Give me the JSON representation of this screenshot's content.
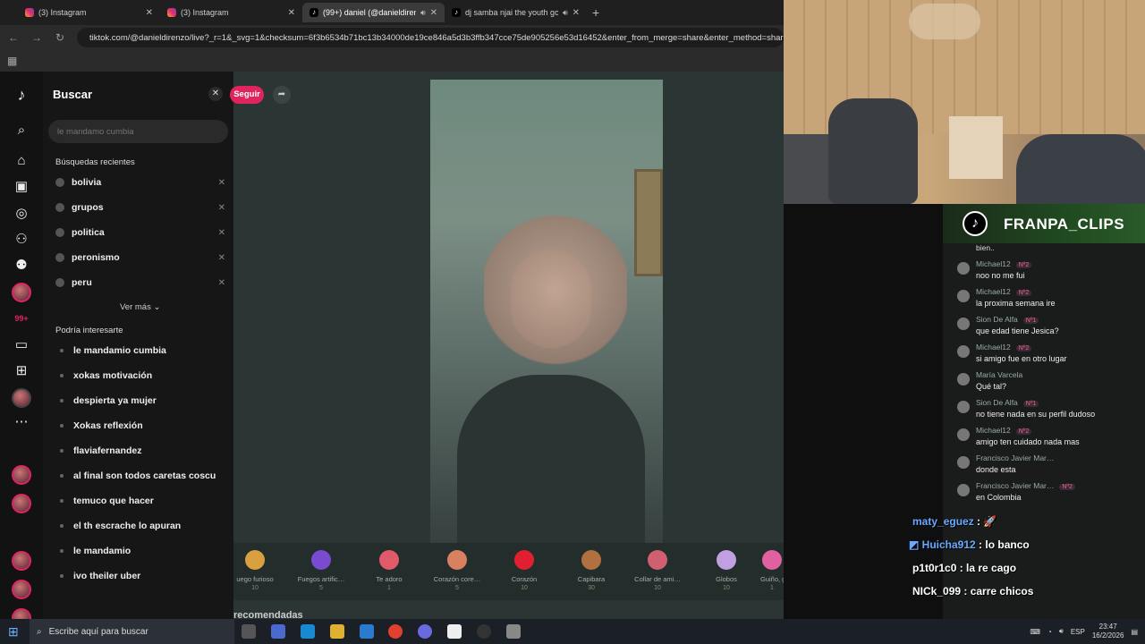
{
  "browser": {
    "tabs": [
      {
        "label": "(3) Instagram",
        "type": "ig",
        "active": false
      },
      {
        "label": "(3) Instagram",
        "type": "ig",
        "active": false
      },
      {
        "label": "(99+) daniel (@danieldirenz",
        "type": "tt",
        "active": true
      },
      {
        "label": "dj samba njai the youth go",
        "type": "tt",
        "active": false
      }
    ],
    "new_tab": "+",
    "url": "tiktok.com/@danieldirenzo/live?_r=1&_svg=1&checksum=6f3b6534b71bc13b34000de19ce846a5d3b3ffb347cce75de905256e53d16452&enter_from_merge=share&enter_method=share&"
  },
  "search_panel": {
    "title": "Buscar",
    "placeholder": "le mandamo cumbia",
    "recent_title": "Búsquedas recientes",
    "recent": [
      "bolivia",
      "grupos",
      "politica",
      "peronismo",
      "peru"
    ],
    "see_more": "Ver más",
    "interesting_title": "Podría interesarte",
    "suggestions": [
      "le mandamio cumbia",
      "xokas motivación",
      "despierta ya mujer",
      "Xokas reflexión",
      "flaviafernandez",
      "al final son todos caretas coscu",
      "temuco que hacer",
      "el th escrache lo apuran",
      "le mandamio",
      "ivo theiler uber"
    ]
  },
  "live": {
    "follow_label": "Seguir",
    "recommended_label": "recomendadas",
    "gifts": [
      {
        "name": "uego furioso",
        "price": "10",
        "color": "#d9a040"
      },
      {
        "name": "Fuegos artific…",
        "price": "5",
        "color": "#7a4ad0"
      },
      {
        "name": "Te adoro",
        "price": "1",
        "color": "#e05a6a"
      },
      {
        "name": "Corazón core…",
        "price": "5",
        "color": "#d88060"
      },
      {
        "name": "Corazón",
        "price": "10",
        "color": "#e02030"
      },
      {
        "name": "Capibara",
        "price": "30",
        "color": "#b07040"
      },
      {
        "name": "Collar de ami…",
        "price": "10",
        "color": "#d06070"
      },
      {
        "name": "Globos",
        "price": "10",
        "color": "#c0a0e0"
      },
      {
        "name": "Guiño, guiño",
        "price": "1",
        "color": "#e060a0"
      }
    ],
    "more_label": "More"
  },
  "chat_overlay": {
    "channel": "FRANPA_CLIPS",
    "cut_top": "bien..",
    "messages": [
      {
        "user": "Michael12",
        "badge": "Nº2",
        "text": "noo no me fui"
      },
      {
        "user": "Michael12",
        "badge": "Nº2",
        "text": "la proxima semana ire"
      },
      {
        "user": "Sion De Alfa",
        "badge": "Nº1",
        "text": "que edad tiene Jesica?"
      },
      {
        "user": "Michael12",
        "badge": "Nº2",
        "text": "si amigo fue en otro lugar"
      },
      {
        "user": "María Varcela",
        "badge": "",
        "text": "Qué tal?"
      },
      {
        "user": "Sion De Alfa",
        "badge": "Nº1",
        "text": "no tiene nada en su perfil dudoso"
      },
      {
        "user": "Michael12",
        "badge": "Nº2",
        "text": "amigo ten cuidado nada mas"
      },
      {
        "user": "Francisco Javier Mar…",
        "badge": "",
        "text": "donde esta"
      },
      {
        "user": "Francisco Javier Mar…",
        "badge": "Nº2",
        "text": "en Colombia"
      }
    ],
    "stream_chat": [
      {
        "user": "maty_eguez",
        "text": " : 🚀"
      },
      {
        "user": "Huicha912",
        "text": " : lo banco"
      },
      {
        "user": "p1t0r1c0",
        "text": " : la re cago"
      },
      {
        "user": "NICk_099",
        "text": " : carre chicos"
      }
    ]
  },
  "taskbar": {
    "search_placeholder": "Escribe aquí para buscar",
    "lang": "ESP",
    "time": "23:47",
    "date": "16/2/2026"
  }
}
